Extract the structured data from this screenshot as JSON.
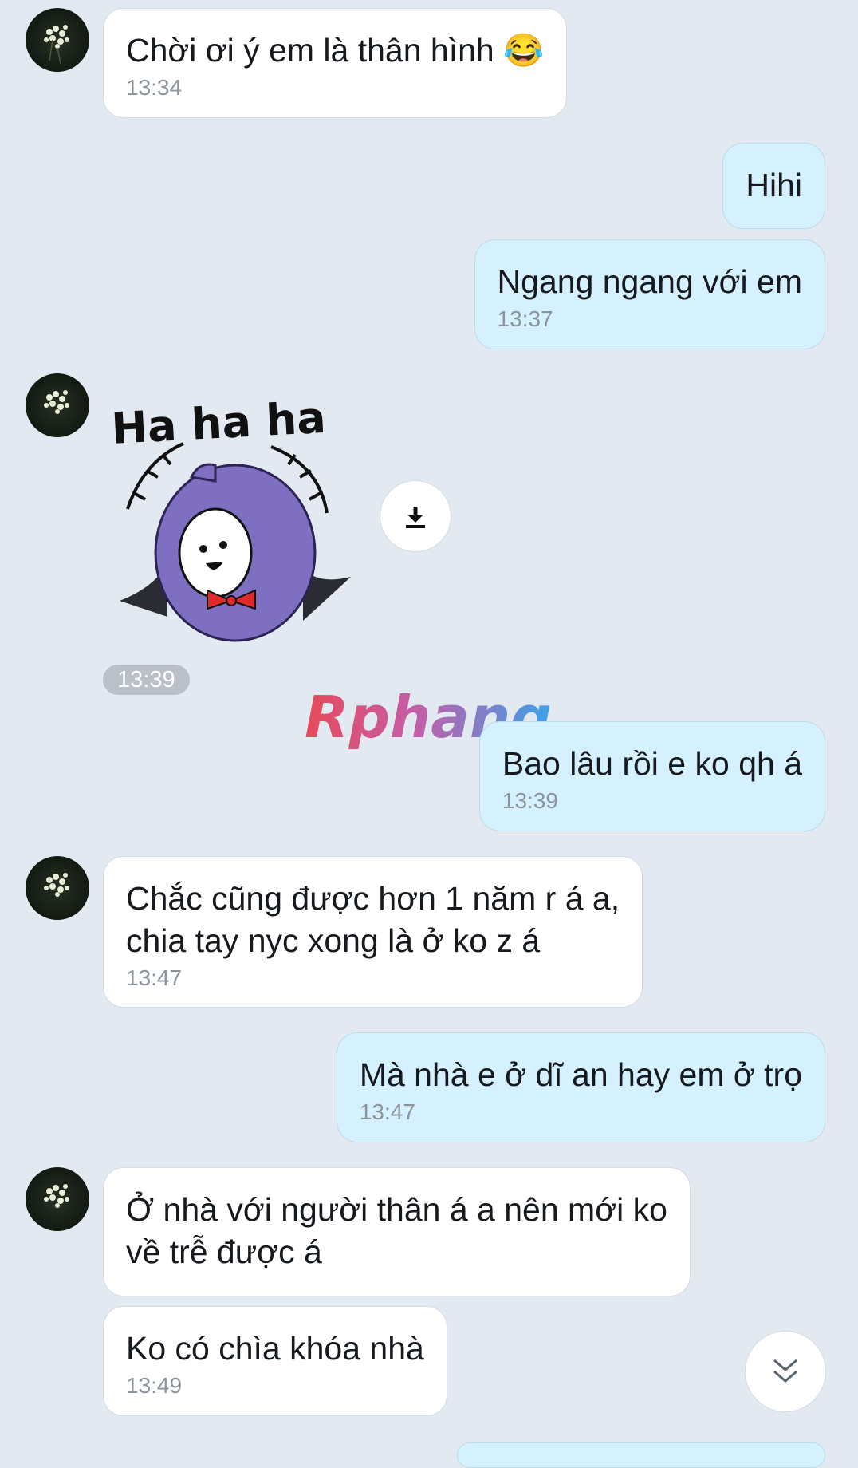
{
  "messages": [
    {
      "text": "Chời ơi ý em là thân hình 😂",
      "time": "13:34"
    },
    {
      "text": "Hihi"
    },
    {
      "text": "Ngang ngang với em",
      "time": "13:37"
    },
    {
      "text": "Bao lâu rồi e ko qh á",
      "time": "13:39"
    },
    {
      "text": "Chắc cũng được hơn 1 năm r á a,\nchia tay nyc xong là ở ko z á",
      "time": "13:47"
    },
    {
      "text": "Mà nhà e ở dĩ an hay em ở trọ",
      "time": "13:47"
    },
    {
      "text": "Ở nhà với người thân á a nên mới ko\nvề trễ được á"
    },
    {
      "text": "Ko có chìa khóa nhà",
      "time": "13:49"
    }
  ],
  "sticker": {
    "text": "Ha ha ha",
    "time": "13:39"
  },
  "watermark": "Rphang",
  "icons": {
    "download": "download-icon",
    "scroll_down": "chevron-double-down-icon",
    "avatar": "flower-avatar"
  },
  "colors": {
    "background": "#e2e9f1",
    "incoming": "#ffffff",
    "outgoing": "#d5f1ff",
    "sticker_purple": "#7e6fc1",
    "bowtie": "#e02a2a"
  }
}
